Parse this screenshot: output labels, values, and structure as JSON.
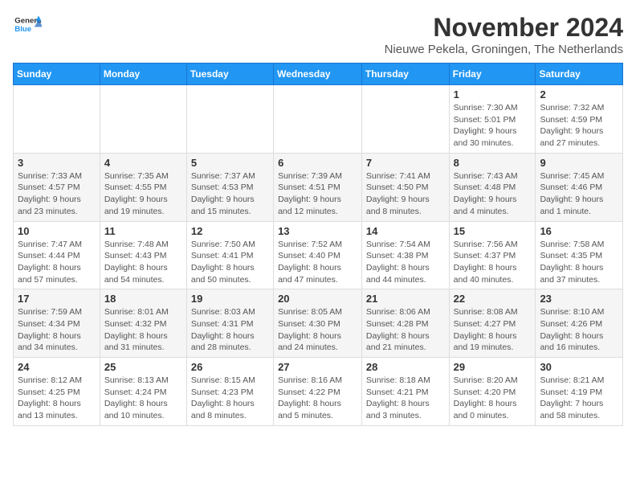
{
  "logo": {
    "general": "General",
    "blue": "Blue"
  },
  "title": "November 2024",
  "location": "Nieuwe Pekela, Groningen, The Netherlands",
  "weekdays": [
    "Sunday",
    "Monday",
    "Tuesday",
    "Wednesday",
    "Thursday",
    "Friday",
    "Saturday"
  ],
  "weeks": [
    [
      {
        "day": "",
        "sunrise": "",
        "sunset": "",
        "daylight": ""
      },
      {
        "day": "",
        "sunrise": "",
        "sunset": "",
        "daylight": ""
      },
      {
        "day": "",
        "sunrise": "",
        "sunset": "",
        "daylight": ""
      },
      {
        "day": "",
        "sunrise": "",
        "sunset": "",
        "daylight": ""
      },
      {
        "day": "",
        "sunrise": "",
        "sunset": "",
        "daylight": ""
      },
      {
        "day": "1",
        "sunrise": "Sunrise: 7:30 AM",
        "sunset": "Sunset: 5:01 PM",
        "daylight": "Daylight: 9 hours and 30 minutes."
      },
      {
        "day": "2",
        "sunrise": "Sunrise: 7:32 AM",
        "sunset": "Sunset: 4:59 PM",
        "daylight": "Daylight: 9 hours and 27 minutes."
      }
    ],
    [
      {
        "day": "3",
        "sunrise": "Sunrise: 7:33 AM",
        "sunset": "Sunset: 4:57 PM",
        "daylight": "Daylight: 9 hours and 23 minutes."
      },
      {
        "day": "4",
        "sunrise": "Sunrise: 7:35 AM",
        "sunset": "Sunset: 4:55 PM",
        "daylight": "Daylight: 9 hours and 19 minutes."
      },
      {
        "day": "5",
        "sunrise": "Sunrise: 7:37 AM",
        "sunset": "Sunset: 4:53 PM",
        "daylight": "Daylight: 9 hours and 15 minutes."
      },
      {
        "day": "6",
        "sunrise": "Sunrise: 7:39 AM",
        "sunset": "Sunset: 4:51 PM",
        "daylight": "Daylight: 9 hours and 12 minutes."
      },
      {
        "day": "7",
        "sunrise": "Sunrise: 7:41 AM",
        "sunset": "Sunset: 4:50 PM",
        "daylight": "Daylight: 9 hours and 8 minutes."
      },
      {
        "day": "8",
        "sunrise": "Sunrise: 7:43 AM",
        "sunset": "Sunset: 4:48 PM",
        "daylight": "Daylight: 9 hours and 4 minutes."
      },
      {
        "day": "9",
        "sunrise": "Sunrise: 7:45 AM",
        "sunset": "Sunset: 4:46 PM",
        "daylight": "Daylight: 9 hours and 1 minute."
      }
    ],
    [
      {
        "day": "10",
        "sunrise": "Sunrise: 7:47 AM",
        "sunset": "Sunset: 4:44 PM",
        "daylight": "Daylight: 8 hours and 57 minutes."
      },
      {
        "day": "11",
        "sunrise": "Sunrise: 7:48 AM",
        "sunset": "Sunset: 4:43 PM",
        "daylight": "Daylight: 8 hours and 54 minutes."
      },
      {
        "day": "12",
        "sunrise": "Sunrise: 7:50 AM",
        "sunset": "Sunset: 4:41 PM",
        "daylight": "Daylight: 8 hours and 50 minutes."
      },
      {
        "day": "13",
        "sunrise": "Sunrise: 7:52 AM",
        "sunset": "Sunset: 4:40 PM",
        "daylight": "Daylight: 8 hours and 47 minutes."
      },
      {
        "day": "14",
        "sunrise": "Sunrise: 7:54 AM",
        "sunset": "Sunset: 4:38 PM",
        "daylight": "Daylight: 8 hours and 44 minutes."
      },
      {
        "day": "15",
        "sunrise": "Sunrise: 7:56 AM",
        "sunset": "Sunset: 4:37 PM",
        "daylight": "Daylight: 8 hours and 40 minutes."
      },
      {
        "day": "16",
        "sunrise": "Sunrise: 7:58 AM",
        "sunset": "Sunset: 4:35 PM",
        "daylight": "Daylight: 8 hours and 37 minutes."
      }
    ],
    [
      {
        "day": "17",
        "sunrise": "Sunrise: 7:59 AM",
        "sunset": "Sunset: 4:34 PM",
        "daylight": "Daylight: 8 hours and 34 minutes."
      },
      {
        "day": "18",
        "sunrise": "Sunrise: 8:01 AM",
        "sunset": "Sunset: 4:32 PM",
        "daylight": "Daylight: 8 hours and 31 minutes."
      },
      {
        "day": "19",
        "sunrise": "Sunrise: 8:03 AM",
        "sunset": "Sunset: 4:31 PM",
        "daylight": "Daylight: 8 hours and 28 minutes."
      },
      {
        "day": "20",
        "sunrise": "Sunrise: 8:05 AM",
        "sunset": "Sunset: 4:30 PM",
        "daylight": "Daylight: 8 hours and 24 minutes."
      },
      {
        "day": "21",
        "sunrise": "Sunrise: 8:06 AM",
        "sunset": "Sunset: 4:28 PM",
        "daylight": "Daylight: 8 hours and 21 minutes."
      },
      {
        "day": "22",
        "sunrise": "Sunrise: 8:08 AM",
        "sunset": "Sunset: 4:27 PM",
        "daylight": "Daylight: 8 hours and 19 minutes."
      },
      {
        "day": "23",
        "sunrise": "Sunrise: 8:10 AM",
        "sunset": "Sunset: 4:26 PM",
        "daylight": "Daylight: 8 hours and 16 minutes."
      }
    ],
    [
      {
        "day": "24",
        "sunrise": "Sunrise: 8:12 AM",
        "sunset": "Sunset: 4:25 PM",
        "daylight": "Daylight: 8 hours and 13 minutes."
      },
      {
        "day": "25",
        "sunrise": "Sunrise: 8:13 AM",
        "sunset": "Sunset: 4:24 PM",
        "daylight": "Daylight: 8 hours and 10 minutes."
      },
      {
        "day": "26",
        "sunrise": "Sunrise: 8:15 AM",
        "sunset": "Sunset: 4:23 PM",
        "daylight": "Daylight: 8 hours and 8 minutes."
      },
      {
        "day": "27",
        "sunrise": "Sunrise: 8:16 AM",
        "sunset": "Sunset: 4:22 PM",
        "daylight": "Daylight: 8 hours and 5 minutes."
      },
      {
        "day": "28",
        "sunrise": "Sunrise: 8:18 AM",
        "sunset": "Sunset: 4:21 PM",
        "daylight": "Daylight: 8 hours and 3 minutes."
      },
      {
        "day": "29",
        "sunrise": "Sunrise: 8:20 AM",
        "sunset": "Sunset: 4:20 PM",
        "daylight": "Daylight: 8 hours and 0 minutes."
      },
      {
        "day": "30",
        "sunrise": "Sunrise: 8:21 AM",
        "sunset": "Sunset: 4:19 PM",
        "daylight": "Daylight: 7 hours and 58 minutes."
      }
    ]
  ]
}
